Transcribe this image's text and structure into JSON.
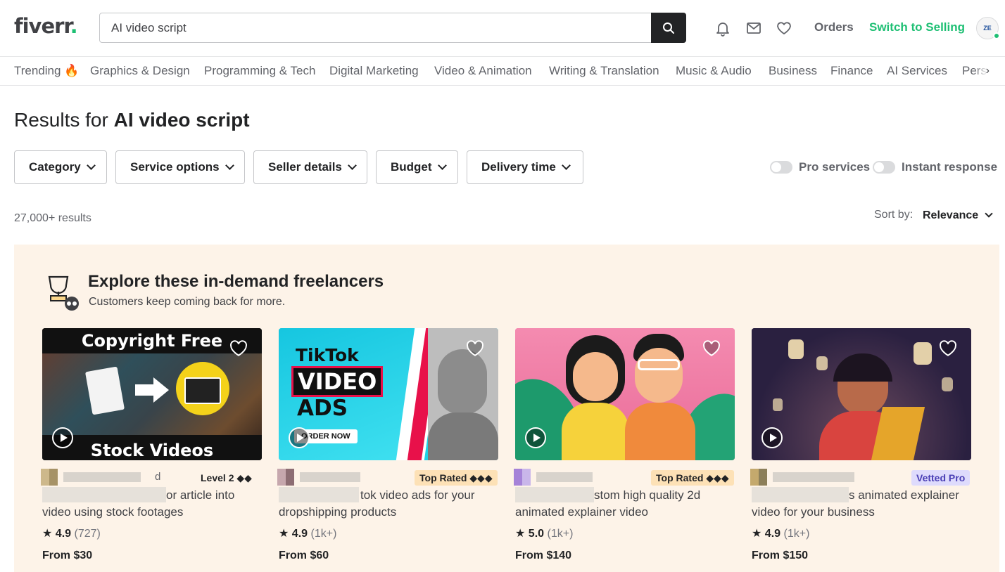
{
  "header": {
    "logo": "fiverr",
    "logo_dot": ".",
    "search_value": "AI video script",
    "orders": "Orders",
    "switch": "Switch to Selling",
    "avatar_text": "ZE"
  },
  "categories": [
    {
      "label": "Trending 🔥"
    },
    {
      "label": "Graphics & Design"
    },
    {
      "label": "Programming & Tech"
    },
    {
      "label": "Digital Marketing"
    },
    {
      "label": "Video & Animation"
    },
    {
      "label": "Writing & Translation"
    },
    {
      "label": "Music & Audio"
    },
    {
      "label": "Business"
    },
    {
      "label": "Finance"
    },
    {
      "label": "AI Services"
    },
    {
      "label": "Pers"
    }
  ],
  "category_more": "›",
  "results": {
    "prefix": "Results for ",
    "query": "AI video script",
    "count": "27,000+ results",
    "sort_label": "Sort by:",
    "sort_value": "Relevance"
  },
  "filters": [
    {
      "label": "Category"
    },
    {
      "label": "Service options"
    },
    {
      "label": "Seller details"
    },
    {
      "label": "Budget"
    },
    {
      "label": "Delivery time"
    }
  ],
  "toggles": [
    {
      "label": "Pro services",
      "on": false
    },
    {
      "label": "Instant response",
      "on": false
    }
  ],
  "promo": {
    "title": "Explore these in-demand freelancers",
    "subtitle": "Customers keep coming back for more."
  },
  "cards": [
    {
      "thumb_top": "Copyright Free",
      "thumb_bottom": "Stock Videos",
      "seller_suffix": "d",
      "badge": "Level 2 ◆◆",
      "title_line1": "or article into",
      "title_line2": "video using stock footages",
      "rating": "4.9",
      "reviews": "(727)",
      "price": "From $30"
    },
    {
      "thumb_top": "TikTok",
      "thumb_mid": "VIDEO",
      "thumb_low": "ADS",
      "thumb_btn": "ORDER NOW",
      "badge": "Top Rated ◆◆◆",
      "title_line1": "tok video ads for your",
      "title_line2": "dropshipping products",
      "rating": "4.9",
      "reviews": "(1k+)",
      "price": "From $60"
    },
    {
      "badge": "Top Rated ◆◆◆",
      "title_line1": "stom high quality 2d",
      "title_line2": "animated explainer video",
      "rating": "5.0",
      "reviews": "(1k+)",
      "price": "From $140"
    },
    {
      "badge": "Vetted Pro",
      "title_line1": "s animated explainer",
      "title_line2": "video for your business",
      "rating": "4.9",
      "reviews": "(1k+)",
      "price": "From $150"
    }
  ],
  "colors": {
    "brand_green": "#1dbf73",
    "promo_bg": "#fdf3e8",
    "top_rated_bg": "#fde1b6",
    "vetted_pro_bg": "#dedbfc"
  },
  "icons": [
    "search-icon",
    "bell-icon",
    "mail-icon",
    "heart-icon",
    "chevron-down-icon",
    "trophy-icon",
    "play-icon",
    "star-icon"
  ]
}
